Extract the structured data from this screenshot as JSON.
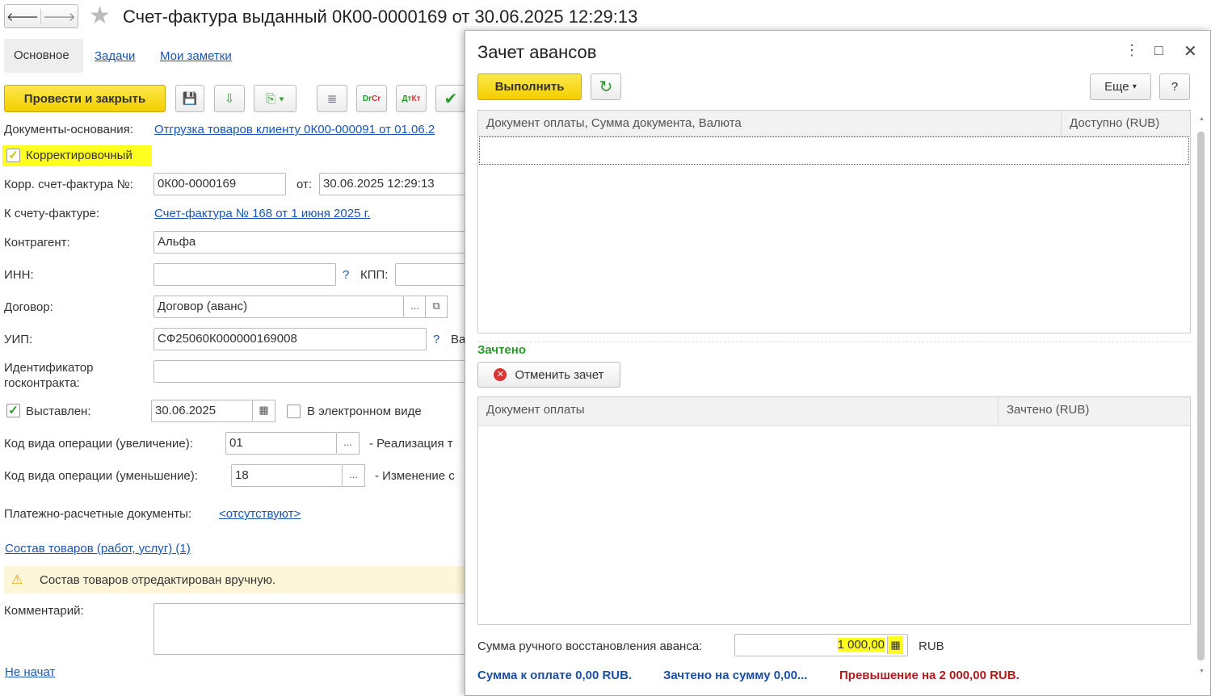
{
  "title": "Счет-фактура выданный 0К00-0000169 от 30.06.2025 12:29:13",
  "tabs": [
    "Основное",
    "Задачи",
    "Мои заметки"
  ],
  "toolbar": {
    "post_close": "Провести и закрыть"
  },
  "form": {
    "base_label": "Документы-основания:",
    "base_link": "Отгрузка товаров клиенту 0К00-000091 от 01.06.2",
    "corrective": "Корректировочный",
    "corr_no_label": "Корр. счет-фактура №:",
    "corr_no": "0К00-0000169",
    "from_label": "от:",
    "from": "30.06.2025 12:29:13",
    "to_invoice_label": "К счету-фактуре:",
    "to_invoice_link": "Счет-фактура № 168 от 1 июня 2025 г.",
    "counterparty_label": "Контрагент:",
    "counterparty": "Альфа",
    "inn_label": "ИНН:",
    "inn": "",
    "q": "?",
    "kpp_label": "КПП:",
    "contract_label": "Договор:",
    "contract": "Договор (аванс)",
    "dots": "...",
    "uip_label": "УИП:",
    "uip": "СФ25060К000000169008",
    "va": "Ва",
    "gov_label1": "Идентификатор",
    "gov_label2": "госконтракта:",
    "issued_label": "Выставлен:",
    "issued": "30.06.2025",
    "electronic": "В электронном виде",
    "op_inc_label": "Код вида операции (увеличение):",
    "op_inc": "01",
    "op_inc_desc": "- Реализация т",
    "op_dec_label": "Код вида операции (уменьшение):",
    "op_dec": "18",
    "op_dec_desc": "- Изменение с",
    "pay_docs_label": "Платежно-расчетные документы:",
    "pay_docs_link": "<отсутствуют>",
    "goods_link": "Состав товаров (работ, услуг) (1)",
    "warning": "Состав товаров отредактирован вручную.",
    "comment_label": "Комментарий:",
    "status_link": "Не начат"
  },
  "dialog": {
    "title": "Зачет авансов",
    "run": "Выполнить",
    "more": "Еще",
    "help": "?",
    "t1_cols": [
      "Документ оплаты, Сумма документа, Валюта",
      "Доступно (RUB)"
    ],
    "credited_title": "Зачтено",
    "cancel": "Отменить зачет",
    "t2_cols": [
      "Документ оплаты",
      "Зачтено (RUB)"
    ],
    "manual_label": "Сумма ручного восстановления аванса:",
    "manual_value": "1 000,00",
    "currency": "RUB",
    "sum_pay": "Сумма к оплате 0,00 RUB.",
    "sum_credited": "Зачтено на сумму 0,00...",
    "excess": "Превышение на 2 000,00 RUB."
  }
}
